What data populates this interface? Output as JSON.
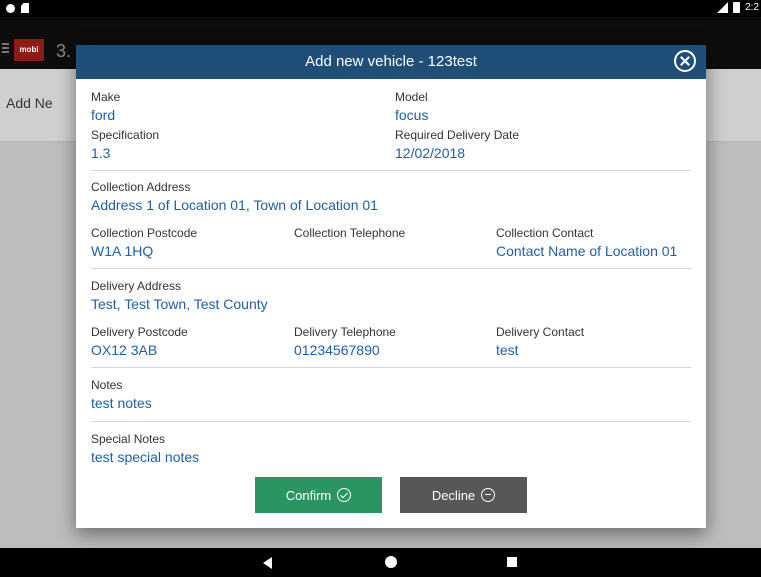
{
  "status_bar": {
    "time": "2:2"
  },
  "app_bar": {
    "title": "3.",
    "logo_text": "mobi"
  },
  "subheader": {
    "text": "Add Ne"
  },
  "dialog": {
    "title": "Add new vehicle - 123test",
    "fields": {
      "make_label": "Make",
      "make_value": "ford",
      "model_label": "Model",
      "model_value": "focus",
      "spec_label": "Specification",
      "spec_value": "1.3",
      "date_label": "Required Delivery Date",
      "date_value": "12/02/2018",
      "col_addr_label": "Collection Address",
      "col_addr_value": "Address 1 of Location 01, Town of Location 01",
      "col_pc_label": "Collection Postcode",
      "col_pc_value": "W1A 1HQ",
      "col_tel_label": "Collection Telephone",
      "col_tel_value": "",
      "col_contact_label": "Collection Contact",
      "col_contact_value": "Contact Name of Location 01",
      "del_addr_label": "Delivery Address",
      "del_addr_value": "Test, Test Town, Test County",
      "del_pc_label": "Delivery Postcode",
      "del_pc_value": "OX12 3AB",
      "del_tel_label": "Delivery Telephone",
      "del_tel_value": "01234567890",
      "del_contact_label": "Delivery Contact",
      "del_contact_value": "test",
      "notes_label": "Notes",
      "notes_value": "test notes",
      "special_label": "Special Notes",
      "special_value": "test special notes"
    },
    "confirm_label": "Confirm",
    "decline_label": "Decline"
  },
  "colors": {
    "header": "#1f4e79",
    "value_text": "#1f5fa8",
    "confirm": "#2a9561",
    "decline": "#575757"
  },
  "icons": {
    "close": "close-circle-icon",
    "confirm": "check-circle-icon",
    "decline": "minus-circle-icon"
  }
}
